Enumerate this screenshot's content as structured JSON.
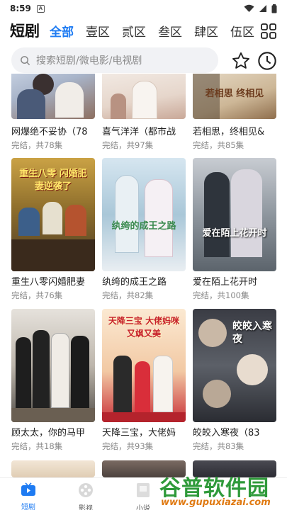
{
  "status_bar": {
    "time": "8:59",
    "app_indicator": "A"
  },
  "categories": {
    "title": "短剧",
    "tabs": [
      "全部",
      "壹区",
      "贰区",
      "叁区",
      "肆区",
      "伍区"
    ],
    "active_index": 0
  },
  "search": {
    "placeholder": "搜索短剧/微电影/电视剧"
  },
  "items": [
    {
      "title": "网爆绝不妥协（78",
      "subtitle": "完结，共78集",
      "poster_text": ""
    },
    {
      "title": "喜气洋洋（都市战",
      "subtitle": "完结，共97集",
      "poster_text": ""
    },
    {
      "title": "若相思，终相见&",
      "subtitle": "完结，共85集",
      "poster_text": "若相思 终相见"
    },
    {
      "title": "重生八零闪婚肥妻",
      "subtitle": "完结，共76集",
      "poster_text": "重生八零 闪婚肥妻逆袭了"
    },
    {
      "title": "纨绔的成王之路",
      "subtitle": "完结，共82集",
      "poster_text": "纨绔的成王之路"
    },
    {
      "title": "爱在陌上花开时",
      "subtitle": "完结，共100集",
      "poster_text": "爱在陌上花开时"
    },
    {
      "title": "顾太太，你的马甲",
      "subtitle": "完结，共18集",
      "poster_text": ""
    },
    {
      "title": "天降三宝，大佬妈",
      "subtitle": "完结，共93集",
      "poster_text": "天降三宝 大佬妈咪又飒又美"
    },
    {
      "title": "皎皎入寒夜（83",
      "subtitle": "完结，共83集",
      "poster_text": "皎皎入寒夜"
    },
    {
      "title": "",
      "subtitle": "",
      "poster_text": ""
    },
    {
      "title": "",
      "subtitle": "",
      "poster_text": ""
    },
    {
      "title": "",
      "subtitle": "",
      "poster_text": ""
    }
  ],
  "bottom_nav": [
    {
      "label": "短剧",
      "icon": "tv-icon",
      "active": true
    },
    {
      "label": "影视",
      "icon": "film-reel-icon",
      "active": false
    },
    {
      "label": "小说",
      "icon": "book-icon",
      "active": false
    }
  ],
  "watermark": {
    "brand": "谷普软件园",
    "url": "www.gupuxiazai.com"
  },
  "colors": {
    "accent": "#1e7bf2",
    "watermark_green": "#2f9a3a",
    "watermark_orange": "#e07a12"
  }
}
